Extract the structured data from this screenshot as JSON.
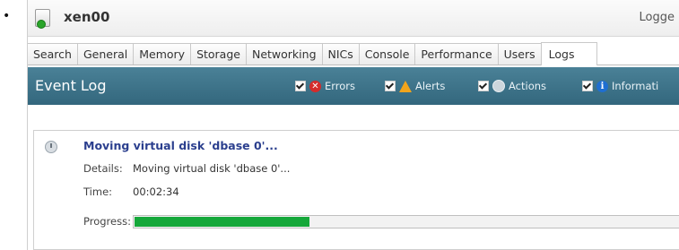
{
  "window": {
    "title": "xen00",
    "logged_in_text": "Logge"
  },
  "tabs": [
    {
      "label": "Search"
    },
    {
      "label": "General"
    },
    {
      "label": "Memory"
    },
    {
      "label": "Storage"
    },
    {
      "label": "Networking"
    },
    {
      "label": "NICs"
    },
    {
      "label": "Console"
    },
    {
      "label": "Performance"
    },
    {
      "label": "Users"
    },
    {
      "label": "Logs",
      "active": true
    }
  ],
  "event_log": {
    "title": "Event Log",
    "filters": [
      {
        "label": "Errors",
        "checked": true,
        "icon": "error-icon"
      },
      {
        "label": "Alerts",
        "checked": true,
        "icon": "alert-icon"
      },
      {
        "label": "Actions",
        "checked": true,
        "icon": "action-icon"
      },
      {
        "label": "Informati",
        "checked": true,
        "icon": "info-icon"
      }
    ]
  },
  "event": {
    "title": "Moving virtual disk 'dbase 0'...",
    "details_label": "Details:",
    "details_value": "Moving virtual disk 'dbase 0'...",
    "time_label": "Time:",
    "time_value": "00:02:34",
    "progress_label": "Progress:",
    "progress_fraction": 0.32
  },
  "colors": {
    "eventbar": "#3a6f85",
    "progress": "#15a83a",
    "event_title": "#2b3f8e"
  }
}
